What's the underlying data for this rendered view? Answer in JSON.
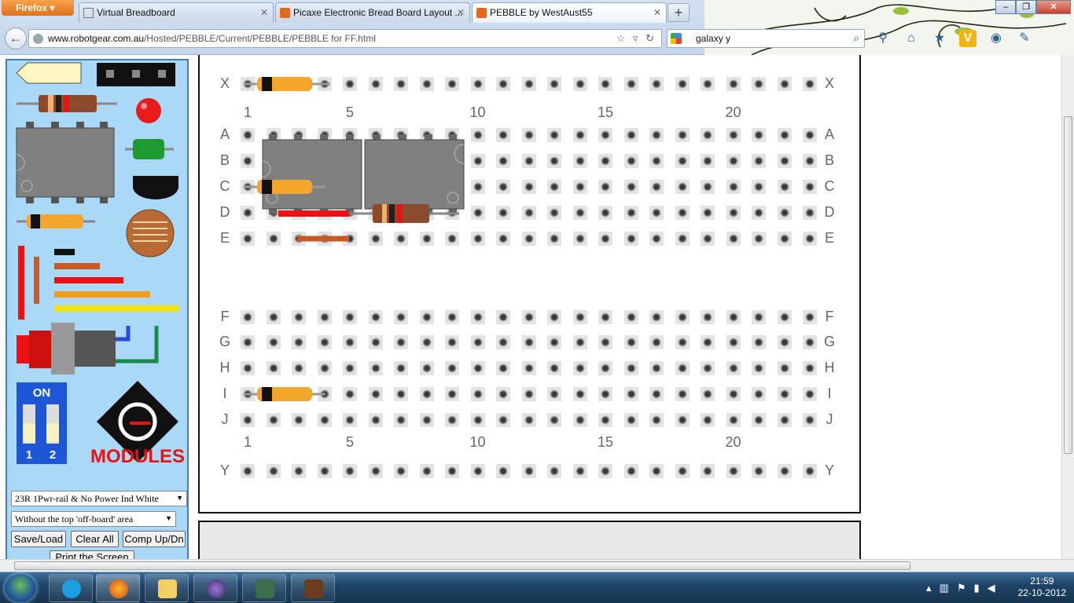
{
  "browser": {
    "menu_button": "Firefox",
    "tabs": [
      {
        "title": "Virtual Breadboard",
        "active": false
      },
      {
        "title": "Picaxe Electronic Bread Board Layout ...",
        "active": false
      },
      {
        "title": "PEBBLE by WestAust55",
        "active": true
      }
    ],
    "url_host": "www.robotgear.com.au",
    "url_path": "/Hosted/PEBBLE/Current/PEBBLE/PEBBLE for FF.html",
    "search_value": "galaxy y"
  },
  "palette": {
    "switch_on_label": "ON",
    "switch_1_label": "1",
    "switch_2_label": "2",
    "logo_text": "MODULES",
    "board_select": "23R 1Pwr-rail & No Power Ind White",
    "area_select": "Without the top 'off-board' area",
    "buttons": {
      "save_load": "Save/Load",
      "clear_all": "Clear All",
      "comp_updn": "Comp Up/Dn",
      "print_screen": "Print the Screen"
    }
  },
  "breadboard": {
    "top_rail_label": "X",
    "bottom_rail_label": "Y",
    "upper_rows": [
      "A",
      "B",
      "C",
      "D",
      "E"
    ],
    "lower_rows": [
      "F",
      "G",
      "H",
      "I",
      "J"
    ],
    "column_numbers": [
      "1",
      "5",
      "10",
      "15",
      "20"
    ],
    "columns": 23
  },
  "taskbar": {
    "time": "21:59",
    "date": "22-10-2012"
  },
  "colors": {
    "palette_bg": "#a9d8f8",
    "resistor_body": "#8b4a2b",
    "led_red": "#e11",
    "capacitor_orange": "#f4a52c",
    "ic_gray": "#808080"
  }
}
